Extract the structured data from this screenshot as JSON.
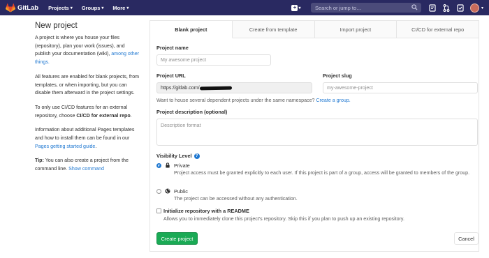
{
  "topnav": {
    "brand": "GitLab",
    "menu": [
      {
        "label": "Projects"
      },
      {
        "label": "Groups"
      },
      {
        "label": "More"
      }
    ],
    "search_placeholder": "Search or jump to…",
    "bg_color": "#292961"
  },
  "sidebar": {
    "title": "New project",
    "p1_text": "A project is where you house your files (repository), plan your work (issues), and publish your documentation (wiki),",
    "p1_link": "among other things.",
    "p2": "All features are enabled for blank projects, from templates, or when importing, but you can disable them afterward in the project settings.",
    "p3_text": "To only use CI/CD features for an external repository, choose",
    "p3_bold": "CI/CD for external repo",
    "p3_end": ".",
    "p4_text": "Information about additional Pages templates and how to install them can be found in our",
    "p4_link": "Pages getting started guide",
    "p4_end": ".",
    "p5_bold": "Tip:",
    "p5_text": "You can also create a project from the command line.",
    "p5_link": "Show command"
  },
  "tabs": [
    {
      "label": "Blank project",
      "active": true
    },
    {
      "label": "Create from template",
      "active": false
    },
    {
      "label": "Import project",
      "active": false
    },
    {
      "label": "CI/CD for external repo",
      "active": false
    }
  ],
  "form": {
    "project_name_label": "Project name",
    "project_name_placeholder": "My awesome project",
    "project_url_label": "Project URL",
    "project_url_value": "https://gitlab.com/",
    "project_slug_label": "Project slug",
    "project_slug_placeholder": "my-awesome-project",
    "namespace_help": "Want to house several dependent projects under the same namespace?",
    "namespace_link": "Create a group.",
    "description_label": "Project description (optional)",
    "description_placeholder": "Description format",
    "visibility_label": "Visibility Level",
    "visibility_options": [
      {
        "title": "Private",
        "icon": "lock-icon",
        "description": "Project access must be granted explicitly to each user. If this project is part of a group, access will be granted to members of the group.",
        "checked": true
      },
      {
        "title": "Public",
        "icon": "globe-icon",
        "description": "The project can be accessed without any authentication.",
        "checked": false
      }
    ],
    "readme_label": "Initialize repository with a README",
    "readme_help": "Allows you to immediately clone this project's repository. Skip this if you plan to push up an existing repository.",
    "readme_checked": false,
    "create_button": "Create project",
    "cancel_button": "Cancel"
  },
  "colors": {
    "accent": "#1f78d1",
    "primary_button": "#1aaa55"
  }
}
